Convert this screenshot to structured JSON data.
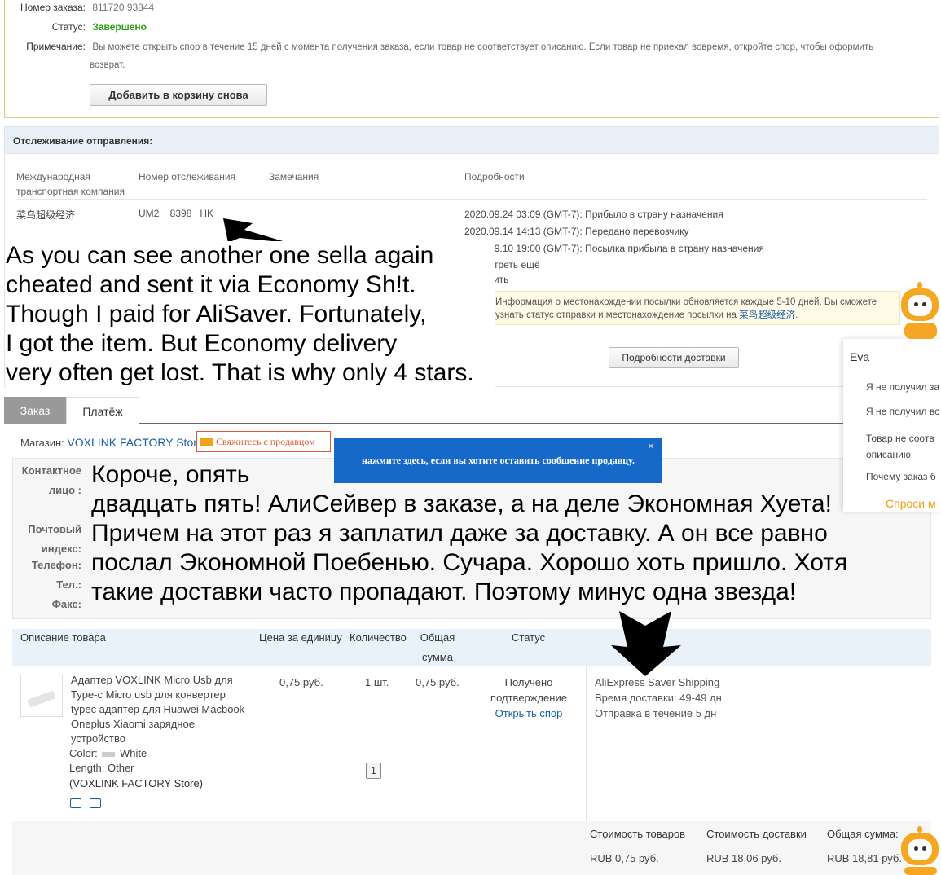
{
  "order": {
    "number_label": "Номер заказа:",
    "number_value": "811720    93844",
    "status_label": "Статус:",
    "status_value": "Завершено",
    "note_label": "Примечание:",
    "note_line1": "Вы можете открыть спор в течение 15 дней с момента получения заказа, если товар не соответствует описанию. Если товар не приехал вовремя, откройте спор, чтобы оформить",
    "note_line2": "возврат.",
    "readd_button": "Добавить в корзину снова"
  },
  "tracking": {
    "title": "Отслеживание отправления:",
    "col_carrier_1": "Международная",
    "col_carrier_2": "транспортная компания",
    "col_number": "Номер отслеживания",
    "col_remarks": "Замечания",
    "col_details": "Подробности",
    "carrier": "菜鸟超级经济",
    "tracking_number": "UM2    8398   HK",
    "events": [
      "2020.09.24 03:09 (GMT-7): Прибыло в страну назначения",
      "2020.09.14 14:13 (GMT-7): Передано перевозчику",
      "2020.09.10 19:00 (GMT-7): Посылка прибыла в страну назначения"
    ],
    "see_more": "Посмотреть ещё",
    "refresh": "Обновить",
    "info_line1": "Информация о местонахождении посылки обновляется каждые 5-10 дней. Вы сможете",
    "info_line2_prefix": "узнать статус отправки и местонахождение посылки на ",
    "info_link": "菜鸟超级经济",
    "info_suffix": ".",
    "details_button": "Подробности доставки"
  },
  "overlay_en": [
    "As you can see another one sella again",
    "cheated and sent it via Economy Sh!t.",
    "Though I paid for AliSaver. Fortunately,",
    "I got the item. But Economy delivery",
    "very often get lost. That is why only 4 stars."
  ],
  "overlay_ru": [
    "Короче, опять",
    "двадцать пять! АлиСейвер в заказе, а на деле Экономная Хуета!",
    "Причем на этот раз я заплатил даже за доставку. А он все равно",
    "послал Экономной Поебенью. Сучара. Хорошо хоть пришло. Хотя",
    "такие доставки часто пропадают. Поэтому минус одна звезда!"
  ],
  "tabs": {
    "order": "Заказ",
    "payment": "Платёж"
  },
  "store": {
    "label": "Магазин:",
    "name": "VOXLINK FACTORY Store",
    "contact_button": "Свяжитесь с продавцом",
    "tooltip": "нажмите здесь, если вы хотите оставить сообщение продавцу.",
    "tooltip_close": "×"
  },
  "contact": {
    "person_1": "Контактное",
    "person_2": "лицо :",
    "postal_1": "Почтовый",
    "postal_2": "индекс:",
    "phone": "Телефон:",
    "tel": "Тел.:",
    "fax": "Факс:"
  },
  "table": {
    "col_desc": "Описание товара",
    "col_price": "Цена за единицу",
    "col_qty": "Количество",
    "col_total_1": "Общая",
    "col_total_2": "сумма",
    "col_status": "Статус",
    "product_title": [
      "Адаптер VOXLINK Micro Usb для",
      "Type-c Micro usb для конвертер",
      "typec адаптер для Huawei Macbook",
      "Oneplus Xiaomi зарядное",
      "устройство"
    ],
    "color_label": "Color:",
    "color_value": "White",
    "length": "Length: Other",
    "store": "(VOXLINK FACTORY Store)",
    "price": "0,75 руб.",
    "qty": "1 шт.",
    "total": "0,75 руб.",
    "status_1": "Получено",
    "status_2": "подтверждение",
    "open_dispute": "Открыть спор",
    "qty_badge": "1",
    "shipping_method": "AliExpress Saver Shipping",
    "delivery_time": "Время доставки:  49-49 дн",
    "dispatch": "Отправка в течение  5 дн"
  },
  "summary": {
    "items_label": "Стоимость товаров",
    "items_value": "RUB 0,75 руб.",
    "shipping_label": "Стоимость доставки",
    "shipping_value": "RUB 18,06 руб.",
    "total_label": "Общая сумма:",
    "total_value": "RUB 18,81 руб."
  },
  "assistant": {
    "name": "Eva",
    "q1": "Я не получил за",
    "q2": "Я не получил вс",
    "q3_1": "Товар не соотв",
    "q3_2": "описанию",
    "q4": "Почему заказ б",
    "ask": "Спроси м"
  },
  "colors": {
    "status_green": "#2a9d0e",
    "link_blue": "#1a5fa6",
    "accent_orange": "#f39c12",
    "price_red": "#c00000",
    "tooltip_blue": "#1769c9"
  }
}
